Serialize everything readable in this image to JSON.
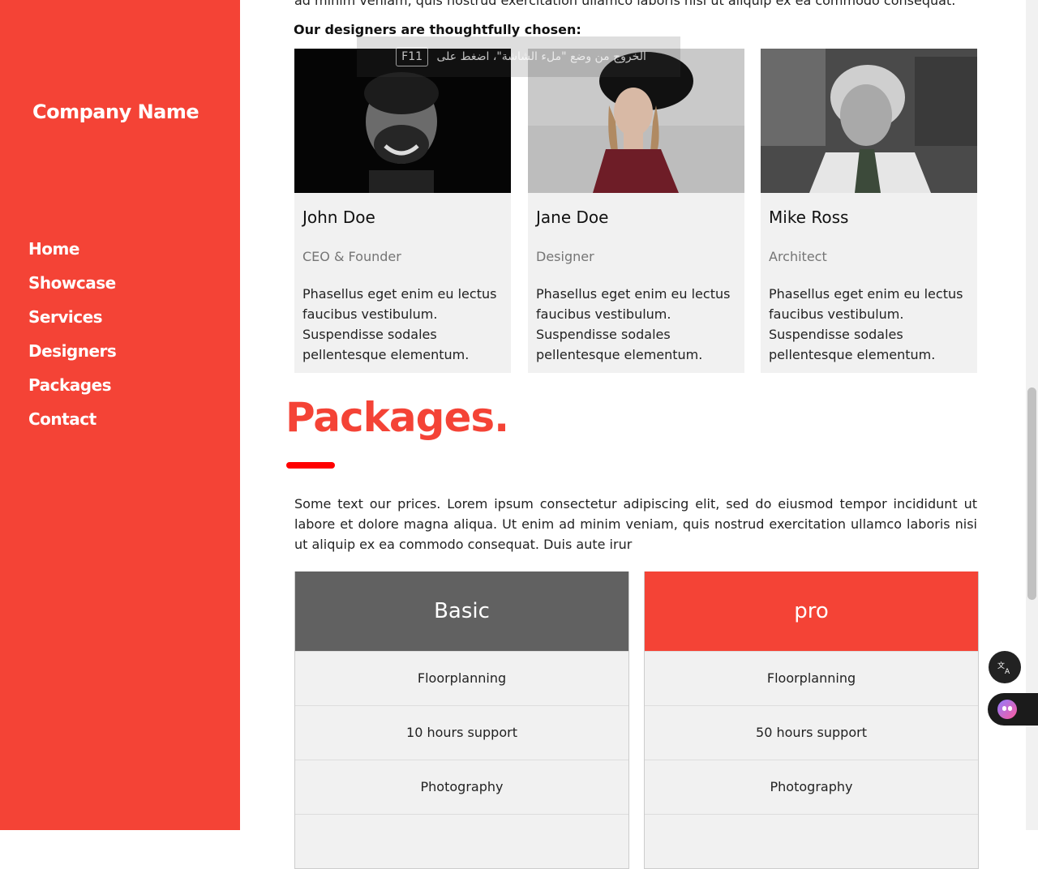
{
  "sidebar": {
    "company": "Company Name",
    "nav": [
      "Home",
      "Showcase",
      "Services",
      "Designers",
      "Packages",
      "Contact"
    ]
  },
  "designers": {
    "cutoff_text": "ad minim veniam, quis nostrud exercitation ullamco laboris nisi ut aliquip ex ea commodo consequat.",
    "intro": "Our designers are thoughtfully chosen:",
    "people": [
      {
        "name": "John Doe",
        "role": "CEO & Founder",
        "desc": "Phasellus eget enim eu lectus faucibus vestibulum. Suspendisse sodales pellentesque elementum."
      },
      {
        "name": "Jane Doe",
        "role": "Designer",
        "desc": "Phasellus eget enim eu lectus faucibus vestibulum. Suspendisse sodales pellentesque elementum."
      },
      {
        "name": "Mike Ross",
        "role": "Architect",
        "desc": "Phasellus eget enim eu lectus faucibus vestibulum. Suspendisse sodales pellentesque elementum."
      }
    ]
  },
  "packages": {
    "title": "Packages.",
    "text": "Some text our prices. Lorem ipsum consectetur adipiscing elit, sed do eiusmod tempor incididunt ut labore et dolore magna aliqua. Ut enim ad minim veniam, quis nostrud exercitation ullamco laboris nisi ut aliquip ex ea commodo consequat. Duis aute irur",
    "plans": [
      {
        "name": "Basic",
        "color": "#616161",
        "rows": [
          "Floorplanning",
          "10 hours support",
          "Photography"
        ]
      },
      {
        "name": "pro",
        "color": "#f44336",
        "rows": [
          "Floorplanning",
          "50 hours support",
          "Photography"
        ]
      }
    ]
  },
  "fullscreen_toast": {
    "text_before": "الخروج من وضع \"ملء الشاشة\"، اضغط على",
    "key": "F11"
  },
  "floating": {
    "translate_icon": "translate-icon",
    "assistant_icon": "assistant-icon"
  },
  "colors": {
    "accent": "#f44336",
    "basic_header": "#616161"
  }
}
